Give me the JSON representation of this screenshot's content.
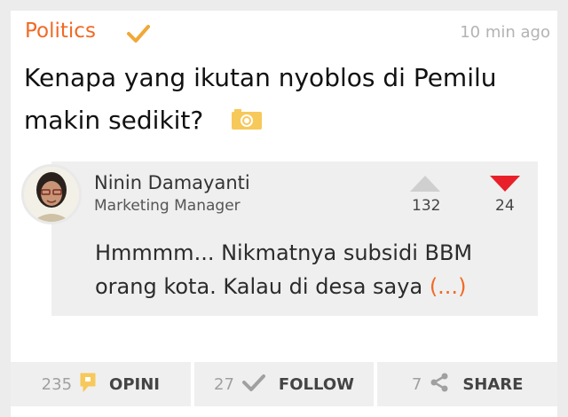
{
  "post": {
    "category": "Politics",
    "time": "10 min ago",
    "title": "Kenapa  yang ikutan nyoblos di Pemilu makin sedikit?"
  },
  "answer": {
    "author_name": "Ninin Damayanti",
    "author_role": "Marketing Manager",
    "upvotes": "132",
    "downvotes": "24",
    "text": "Hmmmm... Nikmatnya subsidi BBM orang kota. Kalau di desa saya",
    "more_label": "(...)"
  },
  "footer": {
    "opini_count": "235",
    "opini_label": "OPINI",
    "follow_count": "27",
    "follow_label": "FOLLOW",
    "share_count": "7",
    "share_label": "SHARE"
  },
  "colors": {
    "accent": "#f06a26",
    "check": "#f0a837",
    "downvote": "#e8202a",
    "upvote": "#cfcfcf"
  }
}
